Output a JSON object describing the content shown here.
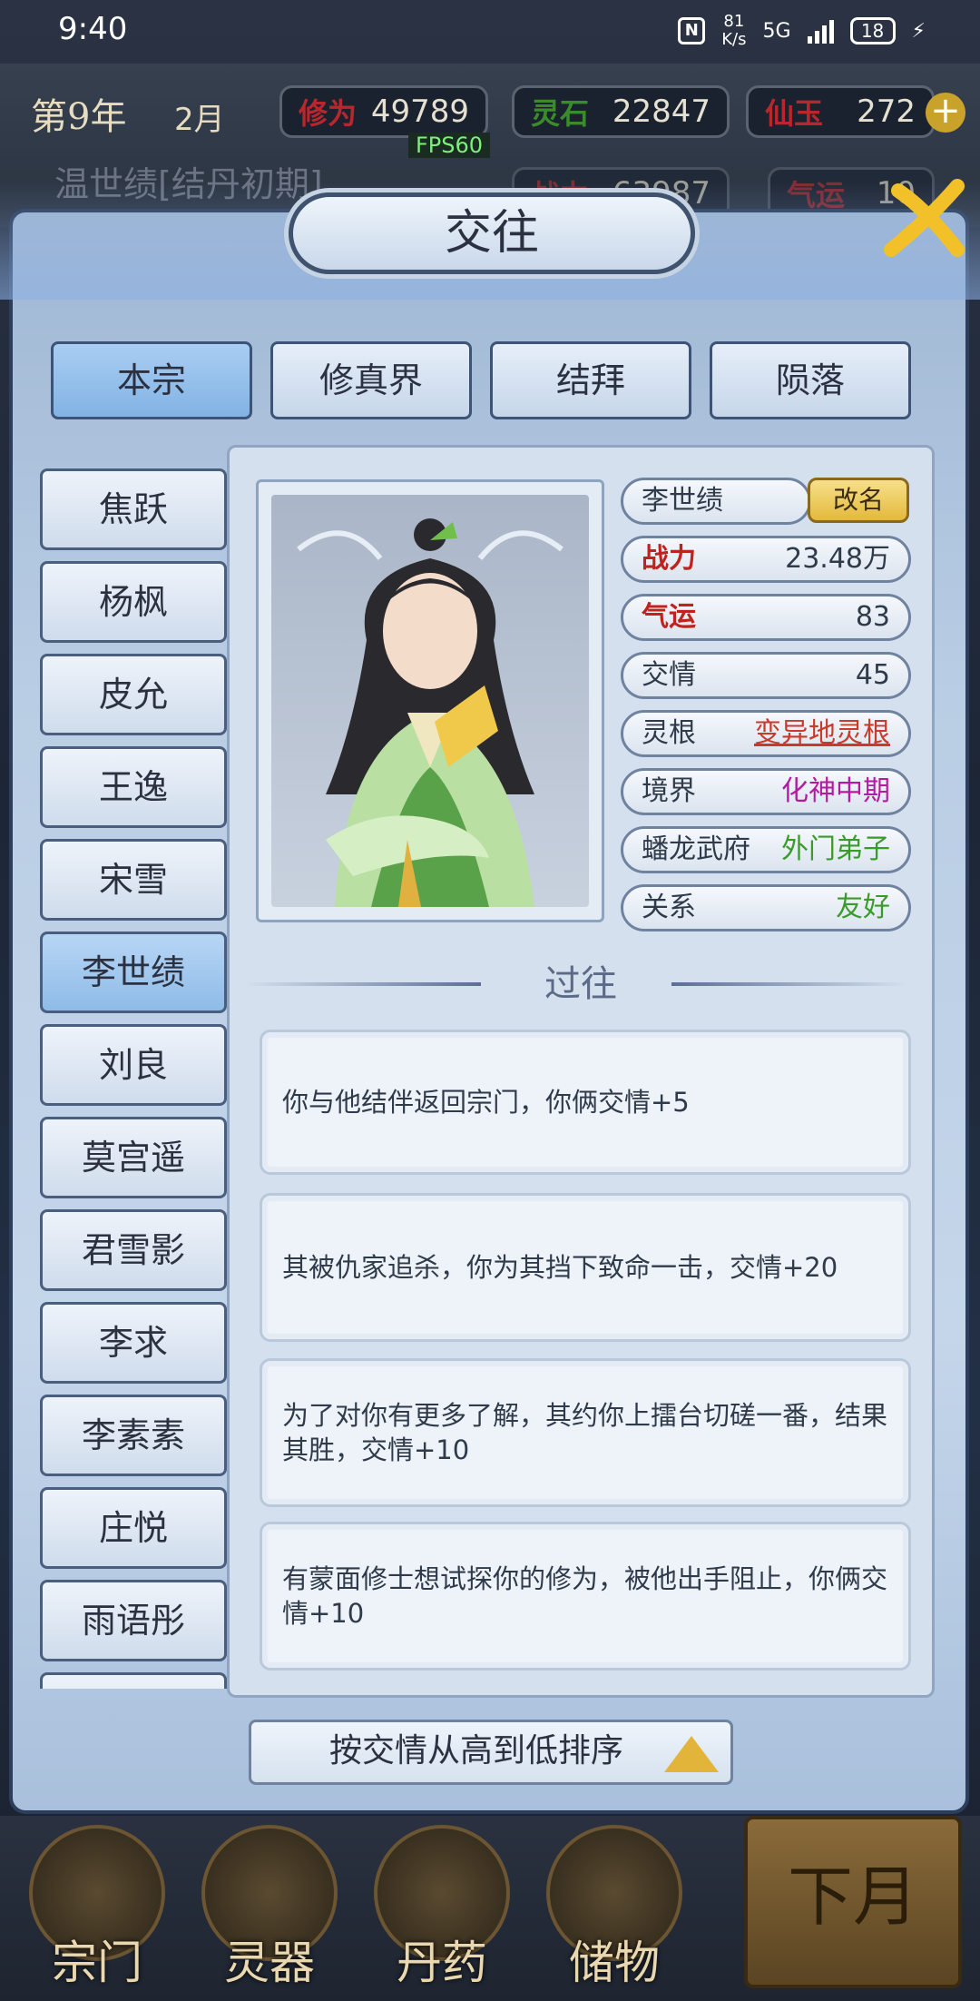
{
  "status": {
    "time": "9:40",
    "net_speed": "81\nK/s",
    "network": "5G",
    "battery": "18",
    "nfc": "N"
  },
  "top": {
    "year": "第9年",
    "month": "2月",
    "resources": [
      {
        "label": "修为",
        "value": "49789",
        "color": "#b8272b"
      },
      {
        "label": "灵石",
        "value": "22847",
        "color": "#3a8c2a"
      },
      {
        "label": "仙玉",
        "value": "272",
        "color": "#b8272b"
      }
    ],
    "row2": [
      {
        "label": "战力",
        "value": "63987"
      },
      {
        "label": "气运",
        "value": "10"
      }
    ],
    "fps": "FPS60",
    "player_name": "温世绩[结丹初期]"
  },
  "dialog": {
    "title": "交往"
  },
  "tabs": [
    "本宗",
    "修真界",
    "结拜",
    "陨落"
  ],
  "active_tab": "本宗",
  "members": [
    "焦跃",
    "杨枫",
    "皮允",
    "王逸",
    "宋雪",
    "李世绩",
    "刘良",
    "莫宫遥",
    "君雪影",
    "李求",
    "李素素",
    "庄悦",
    "雨语彤"
  ],
  "selected_member": "李世绩",
  "detail": {
    "name": "李世绩",
    "rename_label": "改名",
    "stats": [
      {
        "key": "战力",
        "value": "23.48万",
        "key_color": "#c0221e",
        "value_color": "#2f3a4a"
      },
      {
        "key": "气运",
        "value": "83",
        "key_color": "#c0221e",
        "value_color": "#2f3a4a"
      },
      {
        "key": "交情",
        "value": "45",
        "key_color": "#2f3a4a",
        "value_color": "#2f3a4a"
      },
      {
        "key": "灵根",
        "value": "变异地灵根",
        "key_color": "#2f3a4a",
        "value_color": "#c93a2c"
      },
      {
        "key": "境界",
        "value": "化神中期",
        "key_color": "#2f3a4a",
        "value_color": "#b31aa0"
      },
      {
        "key": "蟠龙武府",
        "value": "外门弟子",
        "key_color": "#2f3a4a",
        "value_color": "#3a9b2a"
      },
      {
        "key": "关系",
        "value": "友好",
        "key_color": "#2f3a4a",
        "value_color": "#3a9b2a"
      }
    ],
    "past_title": "过往",
    "events": [
      "你与他结伴返回宗门，你俩交情+5",
      "其被仇家追杀，你为其挡下致命一击，交情+20",
      "为了对你有更多了解，其约你上擂台切磋一番，结果其胜，交情+10",
      "有蒙面修士想试探你的修为，被他出手阻止，你俩交情+10"
    ]
  },
  "sort_label": "按交情从高到低排序",
  "bottom_nav": [
    "宗门",
    "灵器",
    "丹药",
    "储物"
  ],
  "next_month": "下月"
}
